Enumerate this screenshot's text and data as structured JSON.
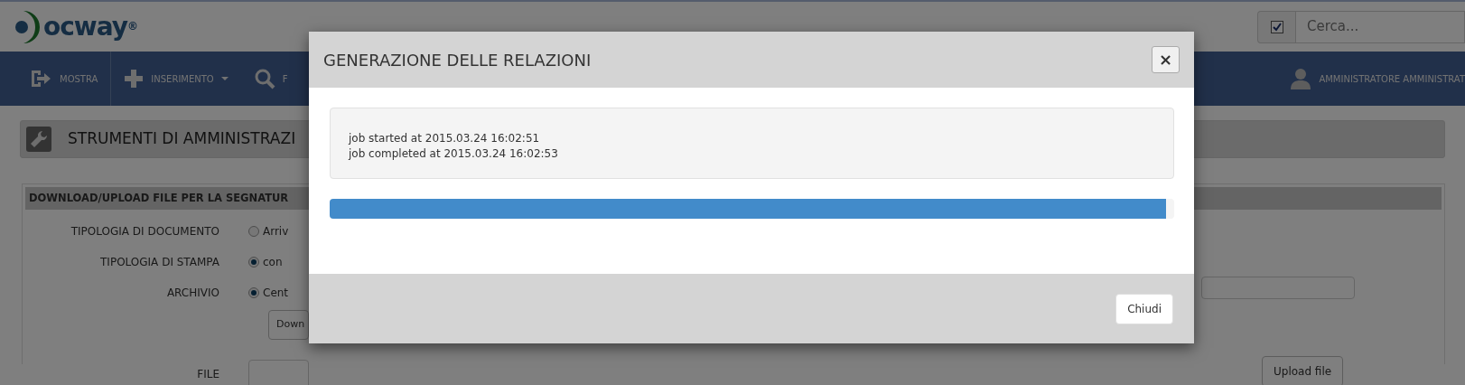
{
  "logo": {
    "text": "ocway$^{®}$"
  },
  "search": {
    "checked": true,
    "placeholder": "Cerca..."
  },
  "nav": {
    "items": [
      {
        "kind": "exit",
        "label": "MOSTRA",
        "dropdown": false
      },
      {
        "kind": "plus",
        "label": "INSERIMENTO",
        "dropdown": true
      },
      {
        "kind": "search",
        "label": "F",
        "dropdown": false
      }
    ],
    "user": "AMMINISTRATORE AMMINISTRAT"
  },
  "page_title": "STRUMENTI DI AMMINISTRAZI",
  "section": {
    "title": "DOWNLOAD/UPLOAD FILE PER LA SEGNATUR",
    "rows": [
      {
        "label": "TIPOLOGIA DI DOCUMENTO",
        "option": {
          "label": "Arriv",
          "selected": false
        }
      },
      {
        "label": "TIPOLOGIA DI STAMPA",
        "option": {
          "label": "con",
          "selected": true
        }
      },
      {
        "label": "ARCHIVIO",
        "option": {
          "label": "Cent",
          "selected": true
        }
      }
    ],
    "download_button": "Down",
    "file_label": "FILE",
    "upload_button": "Upload file"
  },
  "modal": {
    "title": "GENERAZIONE DELLE RELAZIONI",
    "close": "×",
    "log": [
      "job started at 2015.03.24 16:02:51",
      "job completed at 2015.03.24 16:02:53"
    ],
    "progress": {
      "level": 0.99
    },
    "button": "Chiudi"
  }
}
